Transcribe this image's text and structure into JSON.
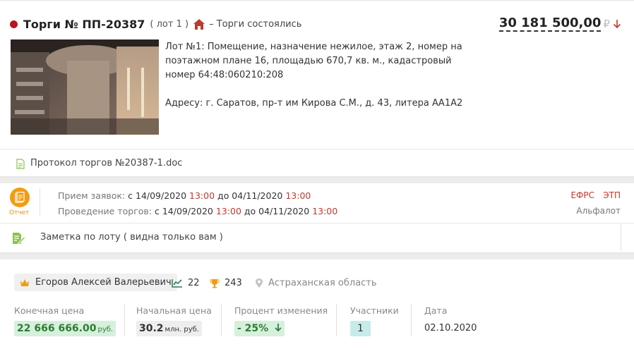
{
  "lot_header": {
    "title": "Торги № ПП-20387",
    "lot": "( лот 1 )",
    "status": "– Торги состоялись",
    "price": "30 181 500,00",
    "currency": "₽"
  },
  "description": "Лот №1: Помещение, назначение нежилое, этаж 2, номер на поэтажном плане 16, площадью 670,7 кв. м., кадастровый номер 64:48:060210:208",
  "address": "Адресу: г. Саратов, пр-т им Кирова С.М., д. 43, литера АА1А2",
  "document": "Протокол торгов №20387-1.doc",
  "schedule": {
    "report_label": "Отчет",
    "app_label": "Прием заявок:",
    "app_from": "с 14/09/2020",
    "app_from_time": "13:00",
    "app_to": "до 04/11/2020",
    "app_to_time": "13:00",
    "auc_label": "Проведение торгов:",
    "auc_from": "с 14/09/2020",
    "auc_from_time": "13:00",
    "auc_to": "до 04/11/2020",
    "auc_to_time": "13:00",
    "efrs": "ЕФРС",
    "etp": "ЭТП",
    "platform": "Альфалот"
  },
  "note_placeholder": "Заметка по лоту ( видна только вам )",
  "bidder": {
    "name": "Егоров Алексей Валерьевич",
    "chart_count": "22",
    "trophy_count": "243",
    "region": "Астраханская область"
  },
  "results": {
    "final_label": "Конечная цена",
    "final_value": "22 666 666.00",
    "final_unit": "руб.",
    "start_label": "Начальная цена",
    "start_value": "30.2",
    "start_unit": "млн. руб.",
    "change_label": "Процент изменения",
    "change_value": "- 25%",
    "participants_label": "Участники",
    "participants_value": "1",
    "date_label": "Дата",
    "date_value": "02.10.2020"
  },
  "colors": {
    "brand_red": "#b8141f",
    "accent_orange": "#f39c12",
    "positive_green": "#2e7d32"
  }
}
